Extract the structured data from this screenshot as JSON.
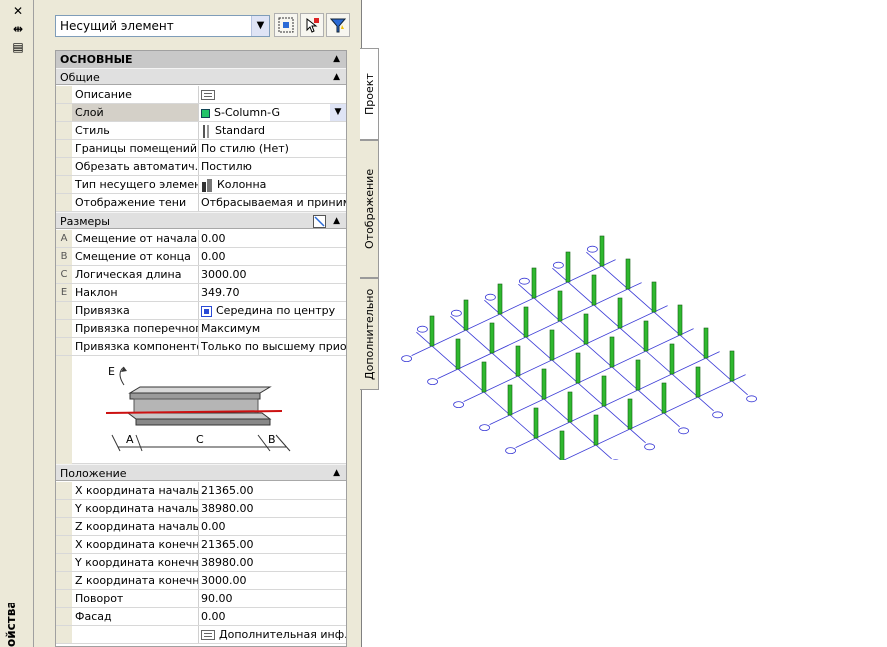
{
  "palette": {
    "title": "ойства",
    "object_type": "Несущий элемент",
    "tabs": [
      "Проект",
      "Отображение",
      "Дополнительно"
    ]
  },
  "categories": {
    "main": "ОСНОВНЫЕ",
    "general": "Общие",
    "dimensions": "Размеры",
    "location": "Положение"
  },
  "general_rows": [
    {
      "label": "Описание",
      "value": ""
    },
    {
      "label": "Слой",
      "value": "S-Column-G"
    },
    {
      "label": "Стиль",
      "value": "Standard"
    },
    {
      "label": "Границы помещений",
      "value": "По стилю (Нет)"
    },
    {
      "label": "Обрезать автоматич...",
      "value": "Постилю"
    },
    {
      "label": "Тип несущего элемента",
      "value": "Колонна"
    },
    {
      "label": "Отображение тени",
      "value": "Отбрасываемая и приним..."
    }
  ],
  "dimension_rows": [
    {
      "key": "A",
      "label": "Смещение от начала",
      "value": "0.00"
    },
    {
      "key": "B",
      "label": "Смещение от конца",
      "value": "0.00"
    },
    {
      "key": "C",
      "label": "Логическая длина",
      "value": "3000.00"
    },
    {
      "key": "E",
      "label": "Наклон",
      "value": "349.70"
    },
    {
      "key": "",
      "label": "Привязка",
      "value": "Середина по центру"
    },
    {
      "key": "",
      "label": "Привязка поперечног...",
      "value": "Максимум"
    },
    {
      "key": "",
      "label": "Привязка компонентов",
      "value": "Только по высшему приор..."
    }
  ],
  "diagram_labels": {
    "a": "A",
    "b": "B",
    "c": "C",
    "e": "E"
  },
  "location_rows": [
    {
      "label": "X координата началь...",
      "value": "21365.00"
    },
    {
      "label": "Y координата началь...",
      "value": "38980.00"
    },
    {
      "label": "Z координата началь...",
      "value": "0.00"
    },
    {
      "label": "X координата конечн...",
      "value": "21365.00"
    },
    {
      "label": "Y координата конечн...",
      "value": "38980.00"
    },
    {
      "label": "Z координата конечн...",
      "value": "3000.00"
    },
    {
      "label": "Поворот",
      "value": "90.00"
    },
    {
      "label": "Фасад",
      "value": "0.00"
    },
    {
      "label": "",
      "value": "Дополнительная инф..."
    }
  ],
  "colors": {
    "column_green": "#2fb82f",
    "grid_blue": "#3b3bd6",
    "layer_swatch": "#22c46a"
  },
  "icons": [
    "close-icon",
    "autohide-icon",
    "properties-menu-icon",
    "select-objects-icon",
    "quick-select-icon",
    "pick-add-icon",
    "quick-calc-icon",
    "description-icon",
    "style-icon",
    "column-type-icon",
    "anchor-icon",
    "more-info-icon"
  ]
}
